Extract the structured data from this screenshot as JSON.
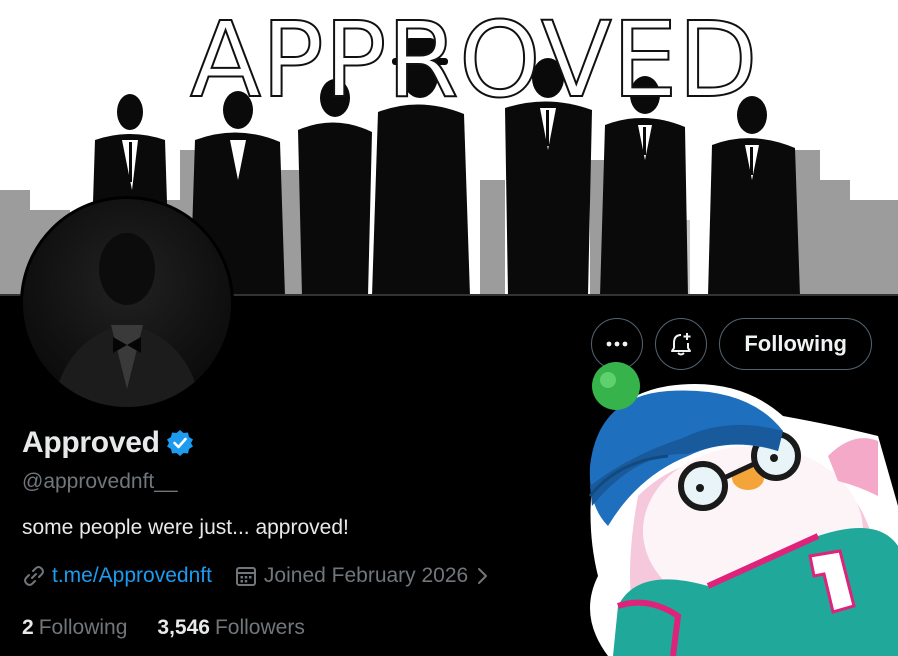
{
  "banner": {
    "title_letters": [
      "A",
      "P",
      "P",
      "R",
      "O",
      "V",
      "E",
      "D"
    ]
  },
  "profile": {
    "display_name": "Approved",
    "handle": "@approvednft__",
    "bio": "some people were just... approved!",
    "link_text": "t.me/Approvednft",
    "joined_text": "Joined February 2026",
    "following_count": "2",
    "following_label": "Following",
    "followers_count": "3,546",
    "followers_label": "Followers",
    "verified": true
  },
  "actions": {
    "follow_state_label": "Following"
  },
  "icons": {
    "more": "more-icon",
    "notify": "bell-plus-icon",
    "verified": "verified-badge-icon",
    "link": "link-icon",
    "calendar": "calendar-icon",
    "chevron": "chevron-right-icon"
  },
  "colors": {
    "accent": "#1d9bf0",
    "muted": "#71767b",
    "text": "#e7e9ea",
    "border": "#536471"
  }
}
